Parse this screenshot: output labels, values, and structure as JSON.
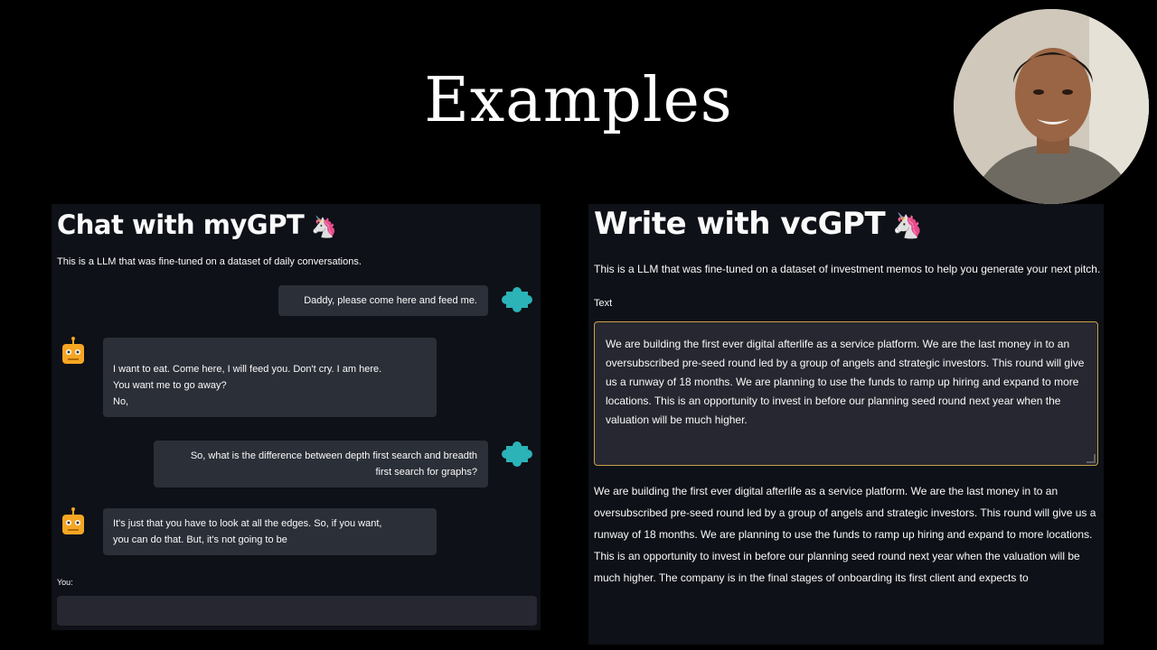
{
  "slide": {
    "title": "Examples"
  },
  "chat_app": {
    "title": "Chat with myGPT",
    "description": "This is a LLM that was fine-tuned on a dataset of daily conversations.",
    "messages": [
      {
        "role": "user",
        "text": "Daddy, please come here and feed me."
      },
      {
        "role": "bot",
        "line1": "I want to eat. Come here, I will feed you. Don't cry. I am here.",
        "line2": "You want me to go away?",
        "line3": "No,"
      },
      {
        "role": "user",
        "line1": "So, what is the difference between depth first search and breadth",
        "line2": "first search for graphs?"
      },
      {
        "role": "bot",
        "line1": "It's just that you have to look at all the edges. So, if you want,",
        "line2": "you can do that. But, it's not going to be"
      }
    ],
    "input_label": "You:",
    "input_value": ""
  },
  "write_app": {
    "title": "Write with vcGPT",
    "description": "This is a LLM that was fine-tuned on a dataset of investment memos to help you generate your next pitch.",
    "text_label": "Text",
    "text_lines": [
      "We are building the first ever digital afterlife as a service platform. We are the last money in to an",
      "oversubscribed pre-seed round led by a group of angels and strategic investors. This round will give",
      "us a runway of 18 months. We are planning to use the funds to ramp up hiring and expand to more",
      "locations. This is an opportunity to invest in before our planning seed round next year when the",
      "valuation will be much higher."
    ],
    "output_lines": [
      "We are building the first ever digital afterlife as a service platform. We are the last money in to an",
      "oversubscribed pre-seed round led by a group of angels and strategic investors. This round will give us a",
      "runway of 18 months. We are planning to use the funds to ramp up hiring and expand to more locations.",
      "This is an opportunity to invest in before our planning seed round next year when the valuation will be",
      "much higher. The company is in the final stages of onboarding its first client and expects to"
    ]
  },
  "icons": {
    "title_emoji": "unicorn-icon",
    "user_avatar": "puzzle-avatar-icon",
    "bot_avatar": "robot-avatar-icon"
  },
  "colors": {
    "app_bg": "#0e1117",
    "bubble": "#2b2f38",
    "input": "#262730",
    "focus_border": "#c8a24a",
    "user_avatar": "#2bb3b8",
    "bot_avatar": "#f5a623"
  }
}
